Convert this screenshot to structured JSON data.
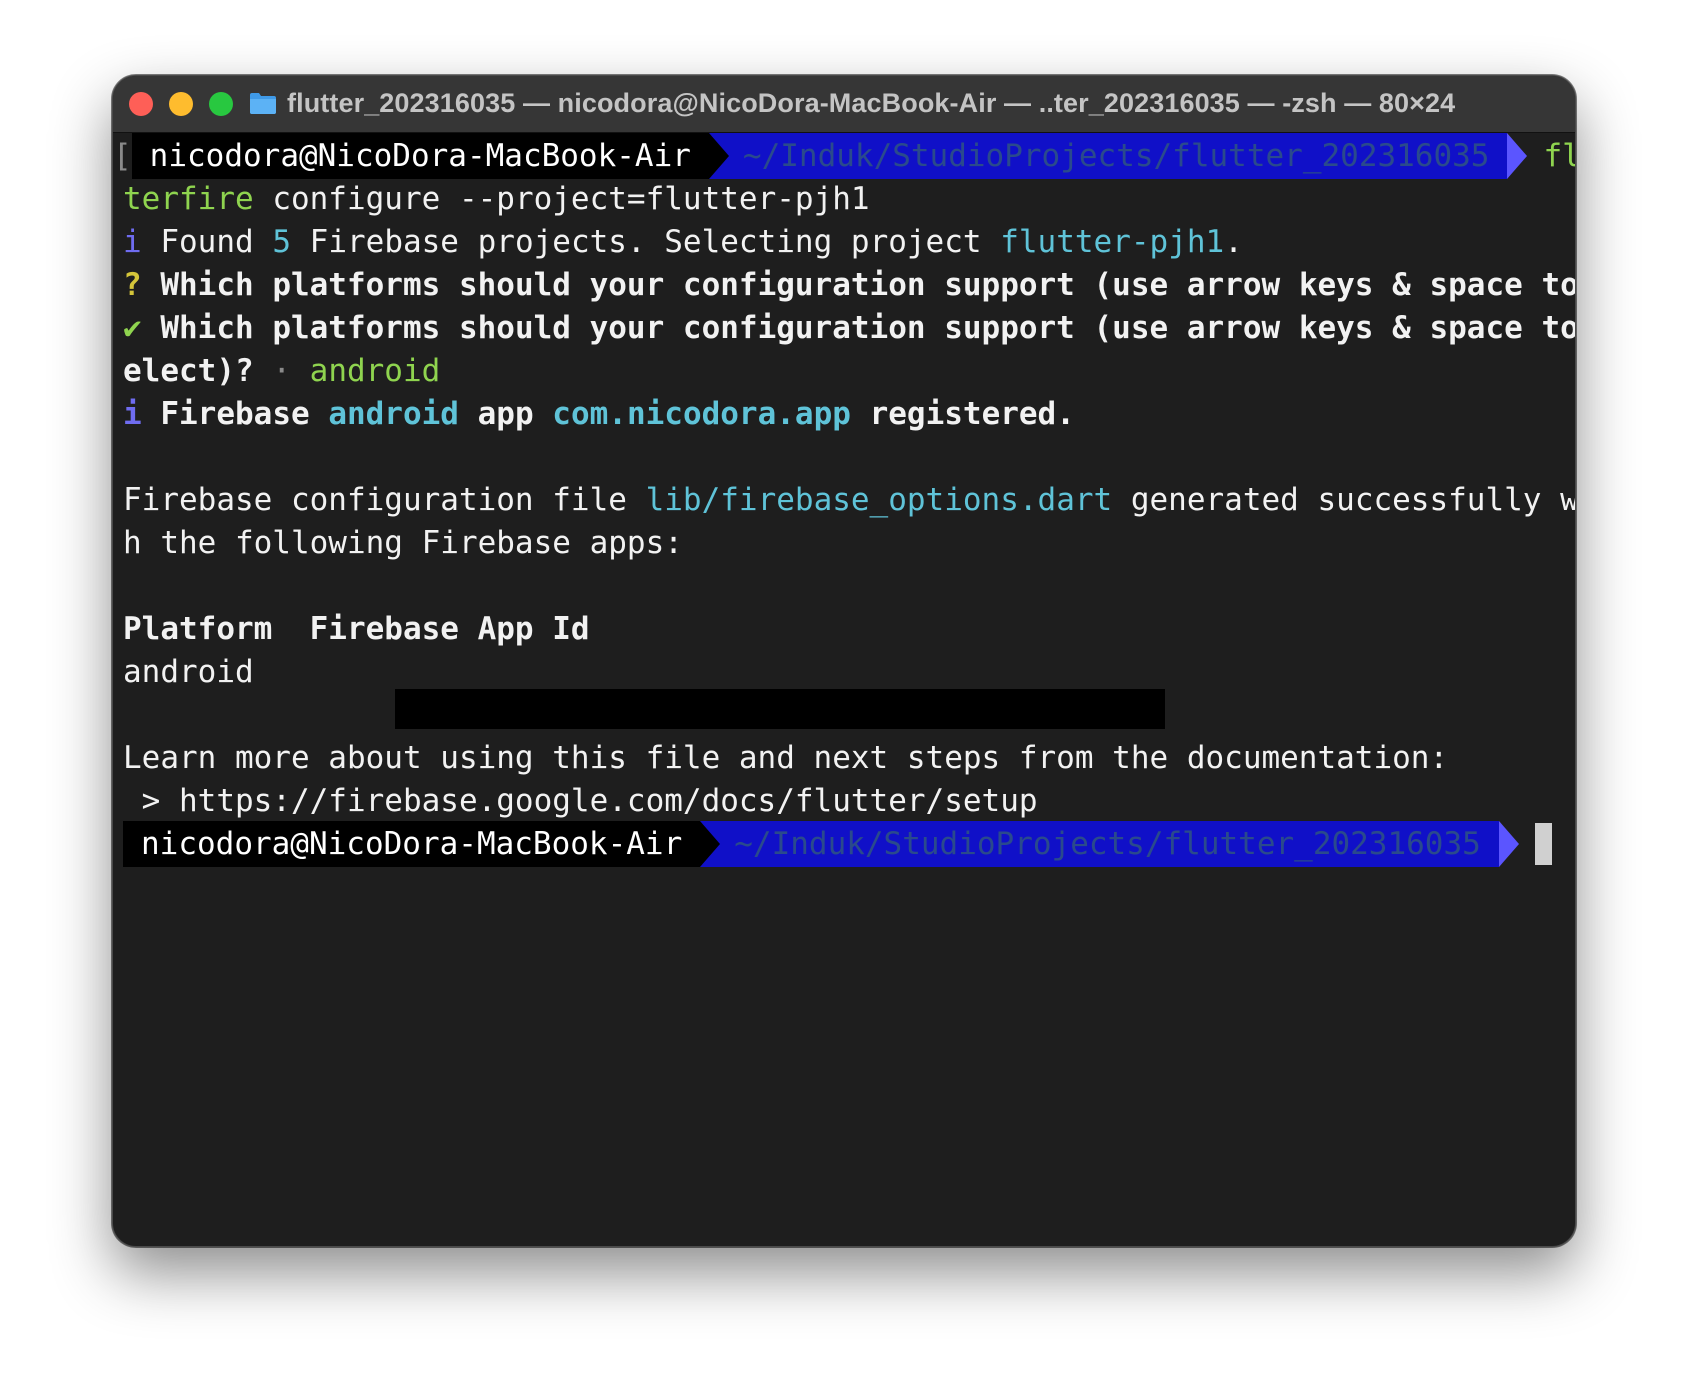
{
  "window": {
    "title": "flutter_202316035 — nicodora@NicoDora-MacBook-Air — ..ter_202316035 — -zsh — 80×24",
    "controls": [
      "close-icon",
      "minimize-icon",
      "zoom-icon"
    ],
    "folder_icon": "folder-icon"
  },
  "prompt": {
    "bracket": "[",
    "user_host": "nicodora@NicoDora-MacBook-Air",
    "path": "~/Induk/StudioProjects/flutter_202316035"
  },
  "lines": {
    "cmd_part1": "flut",
    "cmd_part2": "terfire",
    "cmd_rest": " configure --project=flutter-pjh1",
    "found_prefix": "i",
    "found_a": " Found ",
    "found_num": "5",
    "found_b": " Firebase projects. Selecting project ",
    "found_project": "flutter-pjh1",
    "found_end": ".",
    "q_mark": "?",
    "q_text": " Which platforms should your configuration support (use arrow keys & space to s",
    "check_mark": "✔",
    "check_text": " Which platforms should your configuration support (use arrow keys & space to s",
    "elect_text": "elect)?",
    "elect_dot": " · ",
    "elect_value": "android",
    "reg_prefix": "i",
    "reg_a": " Firebase ",
    "reg_platform": "android",
    "reg_b": " app ",
    "reg_app": "com.nicodora.app",
    "reg_end": " registered.",
    "gen_a": "Firebase configuration file ",
    "gen_file": "lib/firebase_options.dart",
    "gen_b": " generated successfully wit",
    "gen_c": "h the following Firebase apps:",
    "table_header": "Platform  Firebase App Id",
    "table_row_platform": "android",
    "learn": "Learn more about using this file and next steps from the documentation:",
    "url": " > https://firebase.google.com/docs/flutter/setup"
  },
  "colors": {
    "background": "#1e1e1e",
    "green": "#8fd44f",
    "cyan": "#5fc3d8",
    "prompt_path_bg": "#1010c8"
  }
}
